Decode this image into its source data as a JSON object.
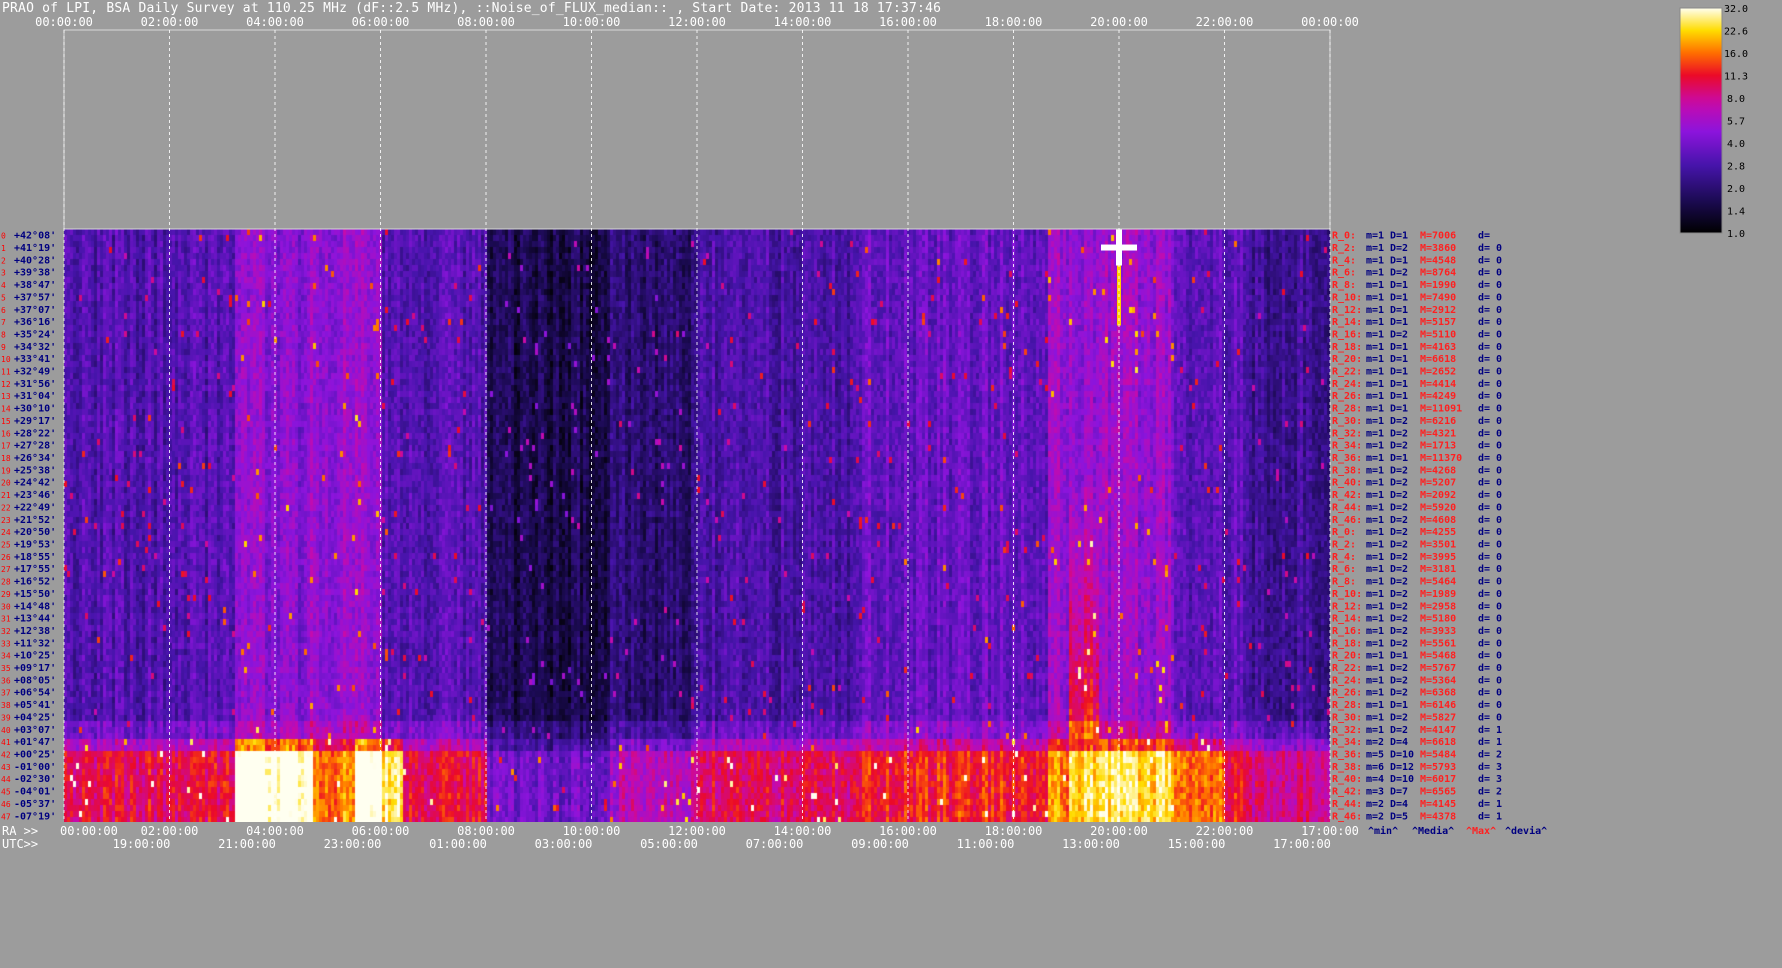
{
  "title": "PRAO of LPI, BSA Daily Survey at 110.25 MHz (dF::2.5 MHz), ::Noise_of_FLUX_median:: , Start Date: 2013 11 18 17:37:46",
  "colors": {
    "background": "#9c9c9c",
    "axis_text": "#ffffff",
    "dec_label": "#000080",
    "row_index": "#ff0000",
    "stats_red": "#ff2020",
    "stats_blue": "#000080"
  },
  "chart_data": {
    "type": "heatmap",
    "colormap": "black-blue-purple-red-yellow-white",
    "top_axis_ticks": [
      "00:00:00",
      "02:00:00",
      "04:00:00",
      "06:00:00",
      "08:00:00",
      "10:00:00",
      "12:00:00",
      "14:00:00",
      "16:00:00",
      "18:00:00",
      "20:00:00",
      "22:00:00",
      "00:00:00"
    ],
    "ra_axis_label": "RA >>",
    "ra_ticks": [
      "00:00:00",
      "02:00:00",
      "04:00:00",
      "06:00:00",
      "08:00:00",
      "10:00:00",
      "12:00:00",
      "14:00:00",
      "16:00:00",
      "18:00:00",
      "20:00:00",
      "22:00:00",
      "17:00:00"
    ],
    "utc_axis_label": "UTC>>",
    "utc_ticks": [
      "19:00:00",
      "21:00:00",
      "23:00:00",
      "01:00:00",
      "03:00:00",
      "05:00:00",
      "07:00:00",
      "09:00:00",
      "11:00:00",
      "13:00:00",
      "15:00:00",
      "17:00:00"
    ],
    "colorbar_ticks": [
      "32.0",
      "22.6",
      "16.0",
      "11.3",
      "8.0",
      "5.7",
      "4.0",
      "2.8",
      "2.0",
      "1.4",
      "1.0"
    ],
    "declinations": [
      "+42°08'",
      "+41°19'",
      "+40°28'",
      "+39°38'",
      "+38°47'",
      "+37°57'",
      "+37°07'",
      "+36°16'",
      "+35°24'",
      "+34°32'",
      "+33°41'",
      "+32°49'",
      "+31°56'",
      "+31°04'",
      "+30°10'",
      "+29°17'",
      "+28°22'",
      "+27°28'",
      "+26°34'",
      "+25°38'",
      "+24°42'",
      "+23°46'",
      "+22°49'",
      "+21°52'",
      "+20°50'",
      "+19°53'",
      "+18°55'",
      "+17°55'",
      "+16°52'",
      "+15°50'",
      "+14°48'",
      "+13°44'",
      "+12°38'",
      "+11°32'",
      "+10°25'",
      "+09°17'",
      "+08°05'",
      "+06°54'",
      "+05°41'",
      "+04°25'",
      "+03°07'",
      "+01°47'",
      "+00°25'",
      "-01°00'",
      "-02°30'",
      "-04°01'",
      "-05°37'",
      "-07°19'"
    ],
    "row_stats": [
      {
        "r": "R_0:",
        "m": "m=1",
        "d": "D=1",
        "M": "M=7006",
        "dv": "d="
      },
      {
        "r": "R_2:",
        "m": "m=1",
        "d": "D=2",
        "M": "M=3860",
        "dv": "d= 0"
      },
      {
        "r": "R_4:",
        "m": "m=1",
        "d": "D=1",
        "M": "M=4548",
        "dv": "d= 0"
      },
      {
        "r": "R_6:",
        "m": "m=1",
        "d": "D=2",
        "M": "M=8764",
        "dv": "d= 0"
      },
      {
        "r": "R_8:",
        "m": "m=1",
        "d": "D=1",
        "M": "M=1990",
        "dv": "d= 0"
      },
      {
        "r": "R_10:",
        "m": "m=1",
        "d": "D=1",
        "M": "M=7490",
        "dv": "d= 0"
      },
      {
        "r": "R_12:",
        "m": "m=1",
        "d": "D=1",
        "M": "M=2912",
        "dv": "d= 0"
      },
      {
        "r": "R_14:",
        "m": "m=1",
        "d": "D=1",
        "M": "M=5157",
        "dv": "d= 0"
      },
      {
        "r": "R_16:",
        "m": "m=1",
        "d": "D=2",
        "M": "M=5110",
        "dv": "d= 0"
      },
      {
        "r": "R_18:",
        "m": "m=1",
        "d": "D=1",
        "M": "M=4163",
        "dv": "d= 0"
      },
      {
        "r": "R_20:",
        "m": "m=1",
        "d": "D=1",
        "M": "M=6618",
        "dv": "d= 0"
      },
      {
        "r": "R_22:",
        "m": "m=1",
        "d": "D=1",
        "M": "M=2652",
        "dv": "d= 0"
      },
      {
        "r": "R_24:",
        "m": "m=1",
        "d": "D=1",
        "M": "M=4414",
        "dv": "d= 0"
      },
      {
        "r": "R_26:",
        "m": "m=1",
        "d": "D=1",
        "M": "M=4249",
        "dv": "d= 0"
      },
      {
        "r": "R_28:",
        "m": "m=1",
        "d": "D=1",
        "M": "M=11091",
        "dv": "d= 0"
      },
      {
        "r": "R_30:",
        "m": "m=1",
        "d": "D=2",
        "M": "M=6216",
        "dv": "d= 0"
      },
      {
        "r": "R_32:",
        "m": "m=1",
        "d": "D=2",
        "M": "M=4321",
        "dv": "d= 0"
      },
      {
        "r": "R_34:",
        "m": "m=1",
        "d": "D=2",
        "M": "M=1713",
        "dv": "d= 0"
      },
      {
        "r": "R_36:",
        "m": "m=1",
        "d": "D=1",
        "M": "M=11370",
        "dv": "d= 0"
      },
      {
        "r": "R_38:",
        "m": "m=1",
        "d": "D=2",
        "M": "M=4268",
        "dv": "d= 0"
      },
      {
        "r": "R_40:",
        "m": "m=1",
        "d": "D=2",
        "M": "M=5207",
        "dv": "d= 0"
      },
      {
        "r": "R_42:",
        "m": "m=1",
        "d": "D=2",
        "M": "M=2092",
        "dv": "d= 0"
      },
      {
        "r": "R_44:",
        "m": "m=1",
        "d": "D=2",
        "M": "M=5920",
        "dv": "d= 0"
      },
      {
        "r": "R_46:",
        "m": "m=1",
        "d": "D=2",
        "M": "M=4608",
        "dv": "d= 0"
      },
      {
        "r": "R_0:",
        "m": "m=1",
        "d": "D=2",
        "M": "M=4255",
        "dv": "d= 0"
      },
      {
        "r": "R_2:",
        "m": "m=1",
        "d": "D=2",
        "M": "M=3501",
        "dv": "d= 0"
      },
      {
        "r": "R_4:",
        "m": "m=1",
        "d": "D=2",
        "M": "M=3995",
        "dv": "d= 0"
      },
      {
        "r": "R_6:",
        "m": "m=1",
        "d": "D=2",
        "M": "M=3181",
        "dv": "d= 0"
      },
      {
        "r": "R_8:",
        "m": "m=1",
        "d": "D=2",
        "M": "M=5464",
        "dv": "d= 0"
      },
      {
        "r": "R_10:",
        "m": "m=1",
        "d": "D=2",
        "M": "M=1989",
        "dv": "d= 0"
      },
      {
        "r": "R_12:",
        "m": "m=1",
        "d": "D=2",
        "M": "M=2958",
        "dv": "d= 0"
      },
      {
        "r": "R_14:",
        "m": "m=1",
        "d": "D=2",
        "M": "M=5180",
        "dv": "d= 0"
      },
      {
        "r": "R_16:",
        "m": "m=1",
        "d": "D=2",
        "M": "M=3933",
        "dv": "d= 0"
      },
      {
        "r": "R_18:",
        "m": "m=1",
        "d": "D=2",
        "M": "M=5561",
        "dv": "d= 0"
      },
      {
        "r": "R_20:",
        "m": "m=1",
        "d": "D=1",
        "M": "M=5468",
        "dv": "d= 0"
      },
      {
        "r": "R_22:",
        "m": "m=1",
        "d": "D=2",
        "M": "M=5767",
        "dv": "d= 0"
      },
      {
        "r": "R_24:",
        "m": "m=1",
        "d": "D=2",
        "M": "M=5364",
        "dv": "d= 0"
      },
      {
        "r": "R_26:",
        "m": "m=1",
        "d": "D=2",
        "M": "M=6368",
        "dv": "d= 0"
      },
      {
        "r": "R_28:",
        "m": "m=1",
        "d": "D=1",
        "M": "M=6146",
        "dv": "d= 0"
      },
      {
        "r": "R_30:",
        "m": "m=1",
        "d": "D=2",
        "M": "M=5827",
        "dv": "d= 0"
      },
      {
        "r": "R_32:",
        "m": "m=1",
        "d": "D=2",
        "M": "M=4147",
        "dv": "d= 1"
      },
      {
        "r": "R_34:",
        "m": "m=2",
        "d": "D=4",
        "M": "M=6618",
        "dv": "d= 1"
      },
      {
        "r": "R_36:",
        "m": "m=5",
        "d": "D=10",
        "M": "M=5484",
        "dv": "d= 2"
      },
      {
        "r": "R_38:",
        "m": "m=6",
        "d": "D=12",
        "M": "M=5793",
        "dv": "d= 3"
      },
      {
        "r": "R_40:",
        "m": "m=4",
        "d": "D=10",
        "M": "M=6017",
        "dv": "d= 3"
      },
      {
        "r": "R_42:",
        "m": "m=3",
        "d": "D=7",
        "M": "M=6565",
        "dv": "d= 2"
      },
      {
        "r": "R_44:",
        "m": "m=2",
        "d": "D=4",
        "M": "M=4145",
        "dv": "d= 1"
      },
      {
        "r": "R_46:",
        "m": "m=2",
        "d": "D=5",
        "M": "M=4378",
        "dv": "d= 1"
      }
    ],
    "footer_labels": [
      "^min^",
      "^Media^",
      "^Max^",
      "^devia^"
    ],
    "footer_colors": [
      "#000080",
      "#000080",
      "#ff2020",
      "#000080"
    ]
  }
}
